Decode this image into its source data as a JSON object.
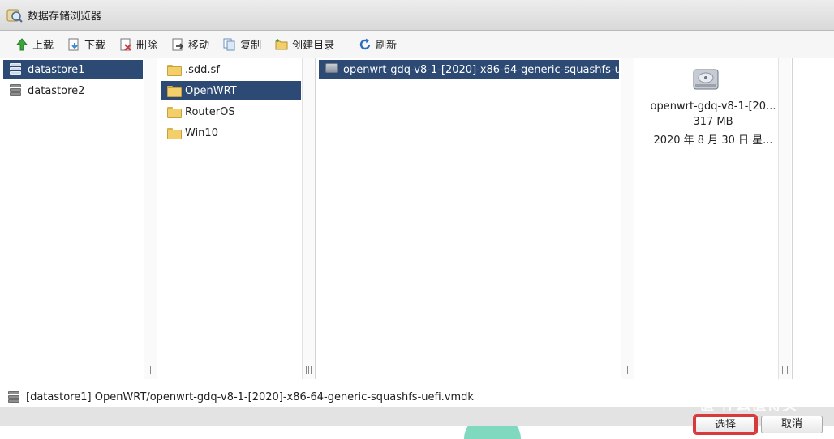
{
  "window": {
    "title": "数据存储浏览器",
    "icon": "datastore-browser-icon"
  },
  "toolbar": {
    "upload": {
      "label": "上载",
      "icon": "upload-arrow-icon"
    },
    "download": {
      "label": "下载",
      "icon": "download-icon"
    },
    "delete": {
      "label": "删除",
      "icon": "delete-icon"
    },
    "move": {
      "label": "移动",
      "icon": "move-icon"
    },
    "copy": {
      "label": "复制",
      "icon": "copy-icon"
    },
    "mkdir": {
      "label": "创建目录",
      "icon": "folder-add-icon"
    },
    "refresh": {
      "label": "刷新",
      "icon": "refresh-icon"
    }
  },
  "datastores": [
    {
      "name": "datastore1",
      "selected": true
    },
    {
      "name": "datastore2",
      "selected": false
    }
  ],
  "folders": [
    {
      "name": ".sdd.sf",
      "selected": false
    },
    {
      "name": "OpenWRT",
      "selected": true
    },
    {
      "name": "RouterOS",
      "selected": false
    },
    {
      "name": "Win10",
      "selected": false
    }
  ],
  "files": [
    {
      "name": "openwrt-gdq-v8-1-[2020]-x86-64-generic-squashfs-u...",
      "selected": true
    }
  ],
  "preview": {
    "name": "openwrt-gdq-v8-1-[20...",
    "size": "317 MB",
    "date": "2020 年 8 月 30 日 星..."
  },
  "pathbar": {
    "path": "[datastore1] OpenWRT/openwrt-gdq-v8-1-[2020]-x86-64-generic-squashfs-uefi.vmdk"
  },
  "footer": {
    "select_label": "选择",
    "cancel_label": "取消"
  },
  "watermark": "值 什么值得买"
}
